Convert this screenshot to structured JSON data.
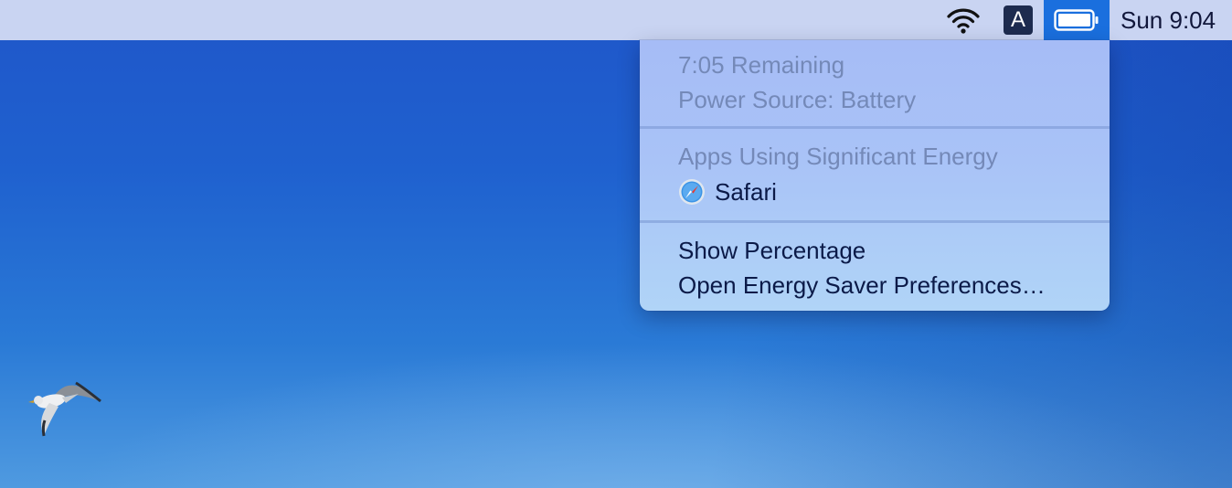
{
  "menubar": {
    "wifi_icon": "wifi-icon",
    "input_source_label": "A",
    "battery_icon": "battery-icon",
    "clock": "Sun 9:04"
  },
  "battery_menu": {
    "time_remaining": "7:05 Remaining",
    "power_source": "Power Source: Battery",
    "energy_header": "Apps Using Significant Energy",
    "apps": [
      {
        "name": "Safari",
        "icon": "safari-compass-icon"
      }
    ],
    "show_percentage": "Show Percentage",
    "open_prefs": "Open Energy Saver Preferences…"
  },
  "colors": {
    "menubar_bg": "#c9d4f2",
    "battery_highlight": "#1a6fde",
    "menu_text": "#0b1a48",
    "menu_disabled_text": "#7489b8"
  }
}
